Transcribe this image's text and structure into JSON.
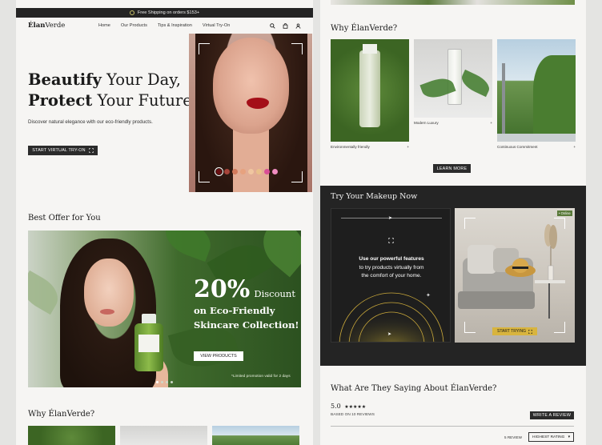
{
  "topbar": {
    "shipping": "Free Shipping on orders $153+"
  },
  "nav": {
    "brand_bold": "Élan",
    "brand_rest": "Verde",
    "links": [
      "Home",
      "Our Products",
      "Tips & Inspiration",
      "Virtual Try-On"
    ],
    "icons": [
      "search-icon",
      "bag-icon",
      "user-icon"
    ]
  },
  "hero": {
    "title_bold_1": "Beautify",
    "title_rest_1": " Your Day,",
    "title_bold_2": "Protect",
    "title_rest_2": " Your Future",
    "subtitle": "Discover natural elegance with our eco-friendly products.",
    "cta": "START VIRTUAL TRY-ON",
    "swatches": [
      "#6a0f12",
      "#a6443a",
      "#d27a5c",
      "#e7a27f",
      "#f0c6a0",
      "#e9c08a",
      "#d94f96",
      "#f08dc1"
    ]
  },
  "offer": {
    "title": "Best Offer for You",
    "percent": "20%",
    "discount": "Discount",
    "line1": "on Eco-Friendly",
    "line2": "Skincare Collection!",
    "cta": "VIEW PRODUCTS",
    "note": "*Limited promotion valid for 2 days"
  },
  "why": {
    "title": "Why ÉlanVerde?",
    "cards": [
      {
        "label": "Environmentally friendly",
        "plus": "+"
      },
      {
        "label": "Modern Luxury",
        "plus": "+"
      },
      {
        "label": "Continuous Commitment",
        "plus": "+"
      }
    ],
    "cta": "LEARN MORE"
  },
  "try": {
    "title": "Try Your Makeup Now",
    "text_bold": "Use our powerful features",
    "text_rest_1": "to try products virtually from",
    "text_rest_2": "the comfort of your home.",
    "online": "• Online",
    "cta": "START TRYING"
  },
  "reviews": {
    "title": "What Are They Saying About ÉlanVerde?",
    "score": "5.0",
    "stars": "★★★★★",
    "based": "BASED ON 10 REVIEWS",
    "cta": "WRITE A REVIEW",
    "filter": "5 REVIEW",
    "sort": "HIGHEST RATING",
    "sort_arrow": "▾"
  },
  "colors": {
    "dark": "#242424",
    "accent_yellow": "#d8b43e",
    "bg": "#f6f5f3"
  }
}
